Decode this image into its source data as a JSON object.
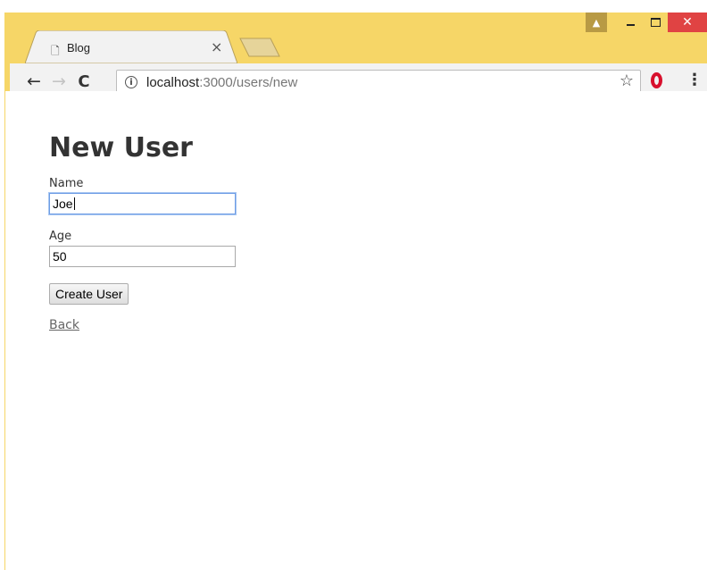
{
  "browser": {
    "tab_title": "Blog",
    "tab_close": "×",
    "url_host": "localhost",
    "url_path": ":3000/users/new",
    "info_glyph": "i"
  },
  "page": {
    "heading": "New User",
    "name_label": "Name",
    "name_value": "Joe",
    "age_label": "Age",
    "age_value": "50",
    "submit_label": "Create User",
    "back_label": "Back"
  },
  "colors": {
    "window_frame": "#f6d667",
    "close_button": "#e04343",
    "opera_red": "#d8102d"
  }
}
